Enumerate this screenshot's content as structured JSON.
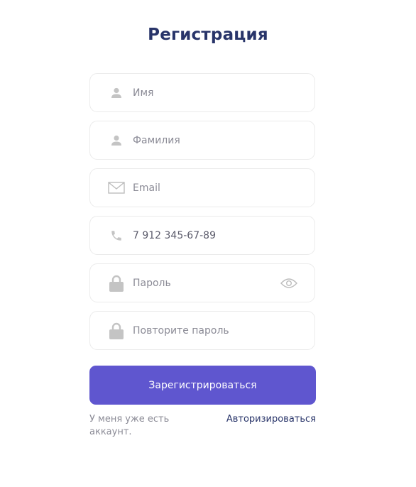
{
  "header": {
    "title": "Регистрация"
  },
  "form": {
    "first_name": {
      "placeholder": "Имя",
      "icon": "user-icon"
    },
    "last_name": {
      "placeholder": "Фамилия",
      "icon": "user-icon"
    },
    "email": {
      "placeholder": "Email",
      "icon": "envelope-icon"
    },
    "phone": {
      "value": "7 912 345-67-89",
      "icon": "phone-icon"
    },
    "password": {
      "placeholder": "Пароль",
      "icon": "lock-icon",
      "toggle_icon": "eye-icon"
    },
    "password_repeat": {
      "placeholder": "Повторите пароль",
      "icon": "lock-icon"
    },
    "submit_label": "Зарегистрироваться"
  },
  "footer": {
    "text": "У меня уже есть аккаунт.",
    "link": "Авторизироваться"
  },
  "colors": {
    "title": "#283469",
    "accent": "#5f56cf",
    "icon": "#c4c4c4",
    "border": "#ebebeb",
    "muted_text": "#8b8b96"
  }
}
